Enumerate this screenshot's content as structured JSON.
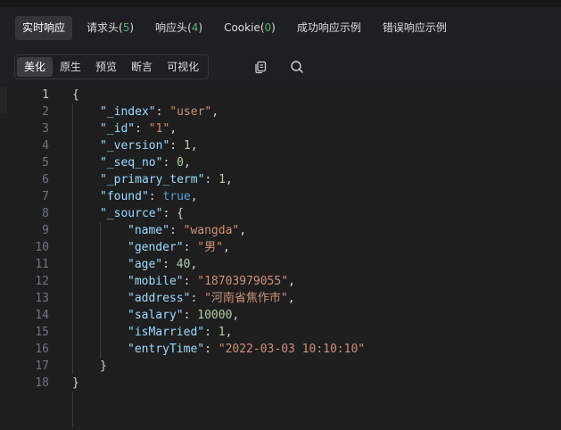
{
  "tabs": [
    {
      "label": "实时响应",
      "count": null,
      "active": true
    },
    {
      "label": "请求头",
      "count": "5",
      "active": false
    },
    {
      "label": "响应头",
      "count": "4",
      "active": false
    },
    {
      "label": "Cookie",
      "count": "0",
      "active": false
    },
    {
      "label": "成功响应示例",
      "count": null,
      "active": false
    },
    {
      "label": "错误响应示例",
      "count": null,
      "active": false
    }
  ],
  "view_modes": [
    {
      "label": "美化",
      "active": true
    },
    {
      "label": "原生",
      "active": false
    },
    {
      "label": "预览",
      "active": false
    },
    {
      "label": "断言",
      "active": false
    },
    {
      "label": "可视化",
      "active": false
    }
  ],
  "tool_icons": [
    "copy-icon",
    "search-icon"
  ],
  "colors": {
    "background": "#1e1f22",
    "editor_bg": "#1e1e1e",
    "key": "#9cdcfe",
    "string": "#ce9178",
    "number": "#b5cea8",
    "boolean": "#569cd6",
    "count": "#57b36f"
  },
  "code": {
    "current_line": 1,
    "lines": [
      {
        "n": "1",
        "indent": 0,
        "tokens": [
          [
            "p",
            "{"
          ]
        ]
      },
      {
        "n": "2",
        "indent": 1,
        "tokens": [
          [
            "k",
            "\"_index\""
          ],
          [
            "p",
            ": "
          ],
          [
            "s",
            "\"user\""
          ],
          [
            "p",
            ","
          ]
        ]
      },
      {
        "n": "3",
        "indent": 1,
        "tokens": [
          [
            "k",
            "\"_id\""
          ],
          [
            "p",
            ": "
          ],
          [
            "s",
            "\"1\""
          ],
          [
            "p",
            ","
          ]
        ]
      },
      {
        "n": "4",
        "indent": 1,
        "tokens": [
          [
            "k",
            "\"_version\""
          ],
          [
            "p",
            ": "
          ],
          [
            "n",
            "1"
          ],
          [
            "p",
            ","
          ]
        ]
      },
      {
        "n": "5",
        "indent": 1,
        "tokens": [
          [
            "k",
            "\"_seq_no\""
          ],
          [
            "p",
            ": "
          ],
          [
            "n",
            "0"
          ],
          [
            "p",
            ","
          ]
        ]
      },
      {
        "n": "6",
        "indent": 1,
        "tokens": [
          [
            "k",
            "\"_primary_term\""
          ],
          [
            "p",
            ": "
          ],
          [
            "n",
            "1"
          ],
          [
            "p",
            ","
          ]
        ]
      },
      {
        "n": "7",
        "indent": 1,
        "tokens": [
          [
            "k",
            "\"found\""
          ],
          [
            "p",
            ": "
          ],
          [
            "b",
            "true"
          ],
          [
            "p",
            ","
          ]
        ]
      },
      {
        "n": "8",
        "indent": 1,
        "tokens": [
          [
            "k",
            "\"_source\""
          ],
          [
            "p",
            ": {"
          ]
        ]
      },
      {
        "n": "9",
        "indent": 2,
        "tokens": [
          [
            "k",
            "\"name\""
          ],
          [
            "p",
            ": "
          ],
          [
            "s",
            "\"wangda\""
          ],
          [
            "p",
            ","
          ]
        ]
      },
      {
        "n": "10",
        "indent": 2,
        "tokens": [
          [
            "k",
            "\"gender\""
          ],
          [
            "p",
            ": "
          ],
          [
            "s",
            "\"男\""
          ],
          [
            "p",
            ","
          ]
        ]
      },
      {
        "n": "11",
        "indent": 2,
        "tokens": [
          [
            "k",
            "\"age\""
          ],
          [
            "p",
            ": "
          ],
          [
            "n",
            "40"
          ],
          [
            "p",
            ","
          ]
        ]
      },
      {
        "n": "12",
        "indent": 2,
        "tokens": [
          [
            "k",
            "\"mobile\""
          ],
          [
            "p",
            ": "
          ],
          [
            "s",
            "\"18703979055\""
          ],
          [
            "p",
            ","
          ]
        ]
      },
      {
        "n": "13",
        "indent": 2,
        "tokens": [
          [
            "k",
            "\"address\""
          ],
          [
            "p",
            ": "
          ],
          [
            "s",
            "\"河南省焦作市\""
          ],
          [
            "p",
            ","
          ]
        ]
      },
      {
        "n": "14",
        "indent": 2,
        "tokens": [
          [
            "k",
            "\"salary\""
          ],
          [
            "p",
            ": "
          ],
          [
            "n",
            "10000"
          ],
          [
            "p",
            ","
          ]
        ]
      },
      {
        "n": "15",
        "indent": 2,
        "tokens": [
          [
            "k",
            "\"isMarried\""
          ],
          [
            "p",
            ": "
          ],
          [
            "n",
            "1"
          ],
          [
            "p",
            ","
          ]
        ]
      },
      {
        "n": "16",
        "indent": 2,
        "tokens": [
          [
            "k",
            "\"entryTime\""
          ],
          [
            "p",
            ": "
          ],
          [
            "s",
            "\"2022-03-03 10:10:10\""
          ]
        ]
      },
      {
        "n": "17",
        "indent": 1,
        "tokens": [
          [
            "p",
            "}"
          ]
        ]
      },
      {
        "n": "18",
        "indent": 0,
        "tokens": [
          [
            "p",
            "}"
          ]
        ]
      }
    ]
  }
}
